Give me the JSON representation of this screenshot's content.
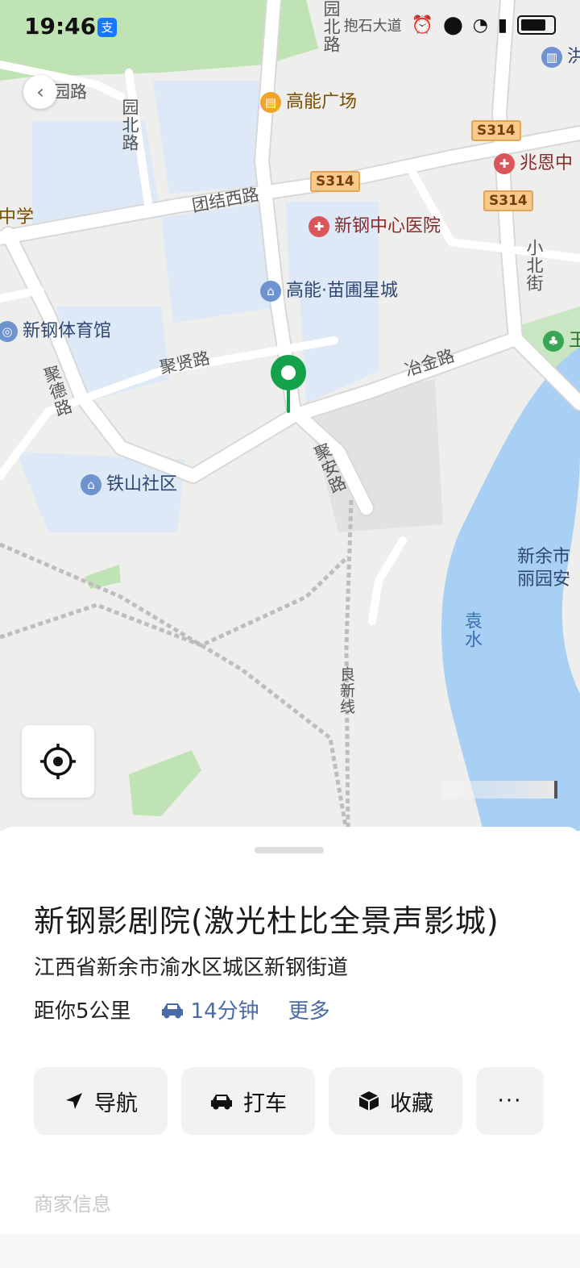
{
  "status_bar": {
    "time": "19:46",
    "pay_badge": "支",
    "carrier_text": "抱石大道"
  },
  "map": {
    "roads": {
      "tuanjie_west": "团结西路",
      "yuanbei_a": "园北路",
      "yuanbei_b": "园北路",
      "yuan_road": "园路",
      "juxian": "聚贤路",
      "jude": "聚德路",
      "yejin": "冶金路",
      "juan": "聚安路",
      "xiaobei": "小北街",
      "liangxin": "良新线"
    },
    "highway_shields": [
      "S314",
      "S314",
      "S314"
    ],
    "pois": {
      "gaoneng_plaza": "高能广场",
      "hospital": "新钢中心医院",
      "zhaoen": "兆恩中",
      "gaoneng_city": "高能·苗圃星城",
      "stadium": "新钢体育馆",
      "tieshan": "铁山社区",
      "school": "中学",
      "xinyu_city": "新余市",
      "liyuan": "丽园安",
      "partial_right": "洪",
      "park_partial": "王"
    },
    "water": {
      "river": "袁水"
    }
  },
  "sheet": {
    "title": "新钢影剧院(激光杜比全景声影城)",
    "address": "江西省新余市渝水区城区新钢街道",
    "distance": "距你5公里",
    "drive_time": "14分钟",
    "more_link": "更多",
    "actions": {
      "navigate": "导航",
      "taxi": "打车",
      "favorite": "收藏",
      "more": "···"
    },
    "merchant_header": "商家信息"
  },
  "colors": {
    "accent_green": "#13a24a",
    "link_blue": "#4a6aa8",
    "river_blue": "#a8d0f5"
  }
}
